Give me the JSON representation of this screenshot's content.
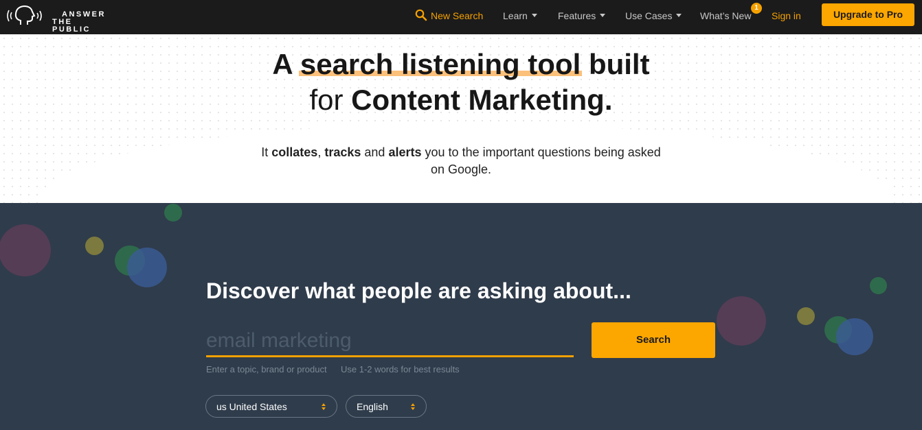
{
  "header": {
    "logo": {
      "line1": "ANSWER",
      "line2": "THE PUBLIC"
    },
    "nav": {
      "new_search": "New Search",
      "learn": "Learn",
      "features": "Features",
      "use_cases": "Use Cases",
      "whats_new": "What’s New",
      "whats_new_badge": "1",
      "sign_in": "Sign in",
      "upgrade": "Upgrade to Pro"
    },
    "icons": {
      "search": "search-icon",
      "caret": "chevron-down-icon",
      "logo": "speaking-head-icon"
    }
  },
  "hero": {
    "headline": {
      "part1": "A",
      "highlight": "search listening tool",
      "part2": "built",
      "part3": "for",
      "bold": "Content Marketing",
      "end": "."
    },
    "sub": {
      "t1": "It",
      "b1": "collates",
      "t2": ",",
      "b2": "tracks",
      "t3": "and",
      "b3": "alerts",
      "t4": "you to the important questions being asked on Google."
    }
  },
  "search": {
    "heading": "Discover what people are asking about...",
    "placeholder": "email marketing",
    "hint1": "Enter a topic, brand or product",
    "hint2": "Use 1-2 words for best results",
    "button": "Search",
    "country": "us United States",
    "language": "English"
  },
  "colors": {
    "accent": "#fca600",
    "nav_bg": "#1b1b1b",
    "dark_bg": "#2f3c4b",
    "highlight": "#fbc07a"
  }
}
